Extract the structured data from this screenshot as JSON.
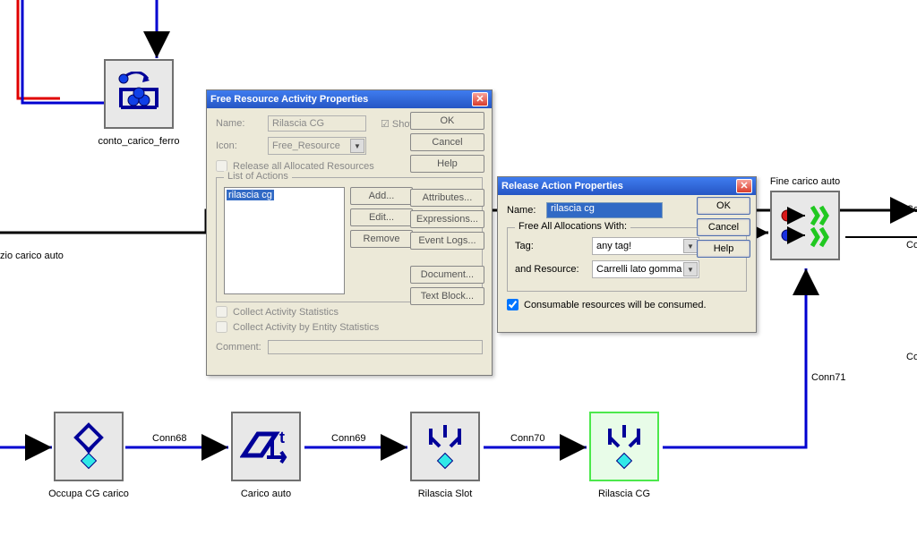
{
  "dialog1": {
    "title": "Free Resource Activity Properties",
    "name_label": "Name:",
    "name_value": "Rilascia CG",
    "show_name_label": "Show Name",
    "icon_label": "Icon:",
    "icon_value": "Free_Resource",
    "release_all_label": "Release all Allocated Resources",
    "list_legend": "List of Actions",
    "list_item": "rilascia cg",
    "btn_add": "Add...",
    "btn_edit": "Edit...",
    "btn_remove": "Remove",
    "btn_ok": "OK",
    "btn_cancel": "Cancel",
    "btn_help": "Help",
    "btn_attributes": "Attributes...",
    "btn_expressions": "Expressions...",
    "btn_eventlogs": "Event Logs...",
    "btn_document": "Document...",
    "btn_textblock": "Text Block...",
    "chk_stats": "Collect Activity Statistics",
    "chk_entity_stats": "Collect Activity by Entity Statistics",
    "comment_label": "Comment:"
  },
  "dialog2": {
    "title": "Release Action Properties",
    "name_label": "Name:",
    "name_value": "rilascia cg",
    "group_legend": "Free All Allocations With:",
    "tag_label": "Tag:",
    "tag_value": "any tag!",
    "res_label": "and Resource:",
    "res_value": "Carrelli lato gomma",
    "chk_consume": "Consumable resources will be consumed.",
    "btn_ok": "OK",
    "btn_cancel": "Cancel",
    "btn_help": "Help"
  },
  "nodes": {
    "conto_carico_ferro": "conto_carico_ferro",
    "zio_carico_auto": "zio carico auto",
    "fine_carico_auto": "Fine carico auto",
    "occupa_cg": "Occupa CG carico",
    "carico_auto": "Carico auto",
    "rilascia_slot": "Rilascia Slot",
    "rilascia_cg": "Rilascia CG"
  },
  "edges": {
    "conn68": "Conn68",
    "conn69": "Conn69",
    "conn70": "Conn70",
    "conn71": "Conn71",
    "co1": "Co",
    "co2": "Co",
    "co3": "Co"
  }
}
